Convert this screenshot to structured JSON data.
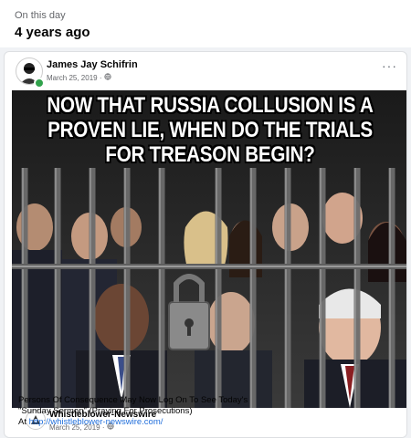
{
  "memory": {
    "label": "On this day",
    "years": "4 years ago"
  },
  "post": {
    "author": "James Jay Schifrin",
    "date": "March 25, 2019 ·",
    "privacy_icon": "globe-icon",
    "more_label": "···",
    "image": {
      "caption": "NOW THAT RUSSIA COLLUSION IS A\nPROVEN LIE, WHEN DO THE TRIALS\nFOR TREASON BEGIN?"
    }
  },
  "shared": {
    "author": "Whistleblower-Newswire",
    "date": "March 25, 2019 ·",
    "privacy_icon": "globe-icon",
    "text_line1": "Persons Of Consequence May Now Log On To See Today's",
    "text_line2": "\"Sunday Sermon\" (Praying For Prosecutions)",
    "text_prefix": "At ",
    "link": "http://whistleblower-newswire.com/"
  },
  "colors": {
    "link": "#216fdb",
    "online": "#31a24c",
    "secondary_text": "#65676b"
  }
}
